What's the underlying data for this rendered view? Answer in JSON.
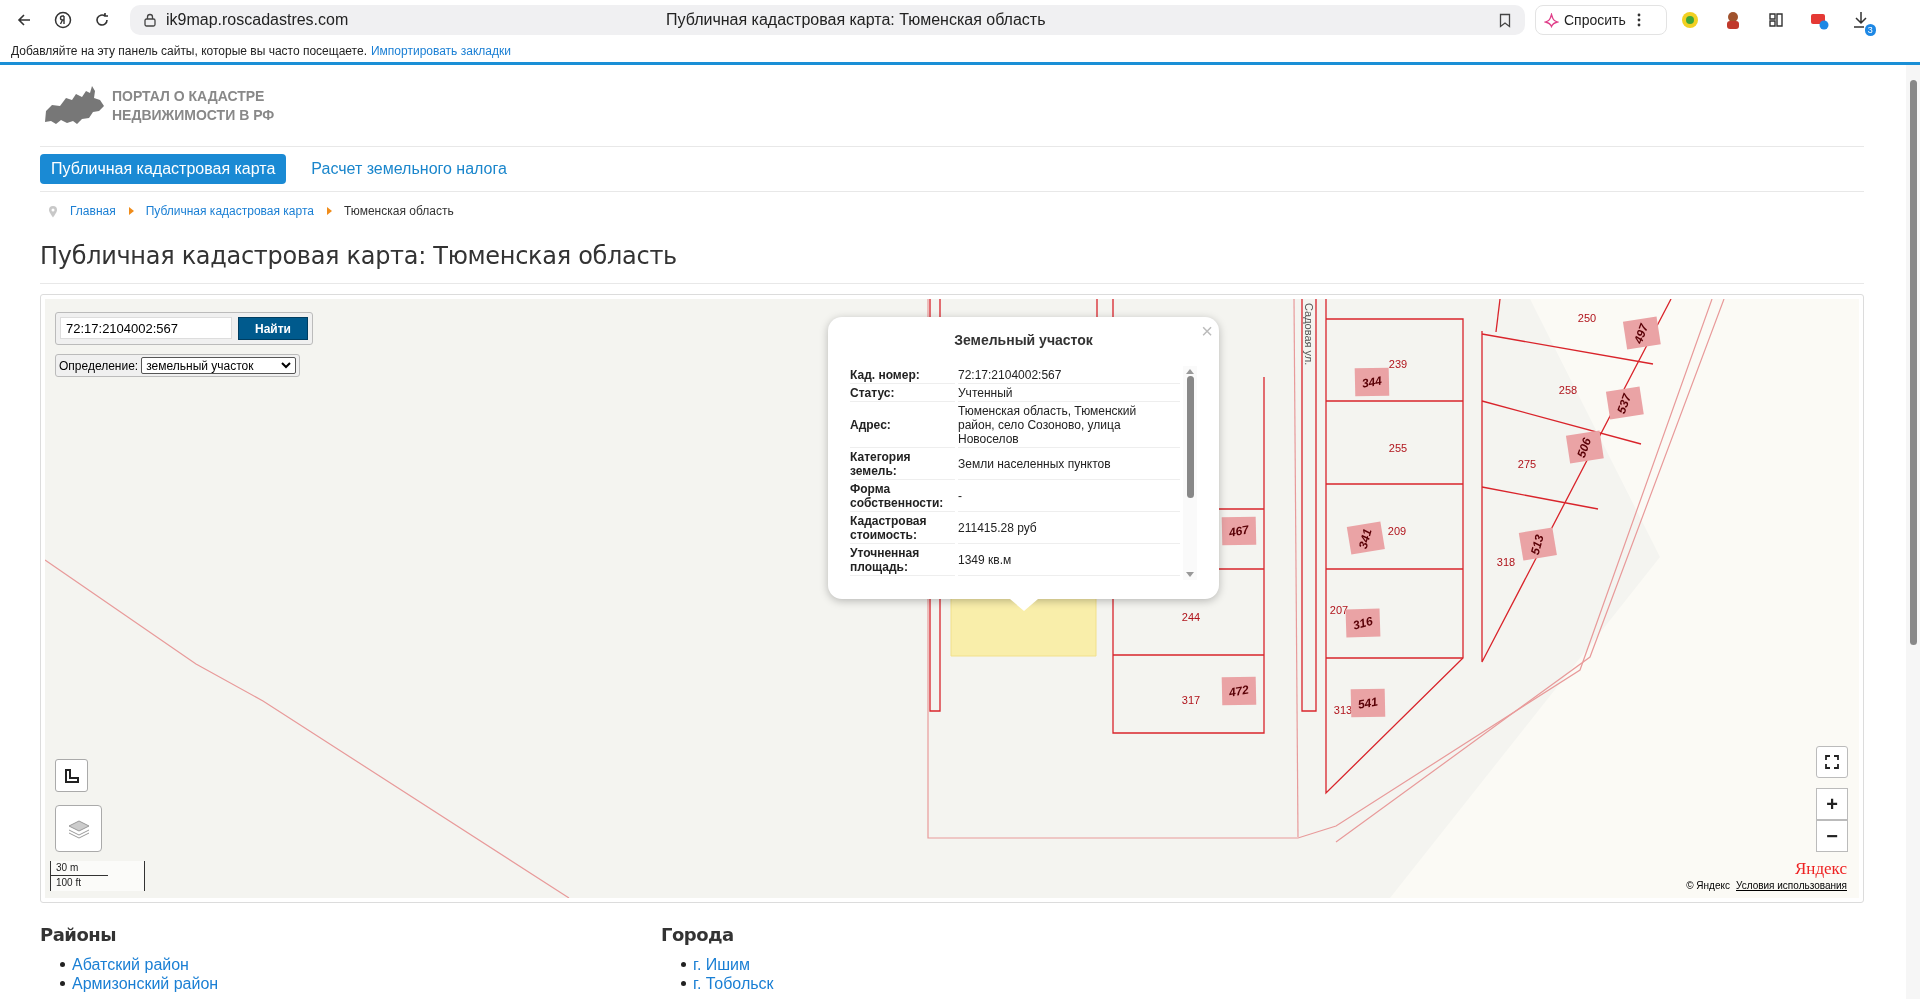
{
  "browser": {
    "url": "ik9map.roscadastres.com",
    "tab_title": "Публичная кадастровая карта: Тюменская область",
    "ask_button": "Спросить",
    "download_badge": "3"
  },
  "bookmarks_bar": {
    "text": "Добавляйте на эту панель сайты, которые вы часто посещаете.",
    "link": "Импортировать закладки"
  },
  "site": {
    "logo_lines": [
      "ПОРТАЛ О КАДАСТРЕ",
      "НЕДВИЖИМОСТИ В РФ"
    ]
  },
  "nav": [
    {
      "label": "Публичная кадастровая карта",
      "selected": true
    },
    {
      "label": "Расчет земельного налога",
      "selected": false
    }
  ],
  "breadcrumbs": [
    {
      "label": "Главная",
      "kind": "link"
    },
    {
      "label": "Публичная кадастровая карта",
      "kind": "link"
    },
    {
      "label": "Тюменская область",
      "kind": "current"
    }
  ],
  "heading": "Публичная кадастровая карта: Тюменская область",
  "map": {
    "search": {
      "value": "72:17:2104002:567",
      "button": "Найти"
    },
    "definition": {
      "label": "Определение:",
      "value": "земельный участок"
    },
    "street_label": "Садовая ул.",
    "plot_labels": [
      {
        "text": "250",
        "kind": "plot"
      },
      {
        "text": "497",
        "kind": "building"
      },
      {
        "text": "239",
        "kind": "plot"
      },
      {
        "text": "344",
        "kind": "building"
      },
      {
        "text": "258",
        "kind": "plot"
      },
      {
        "text": "537",
        "kind": "building"
      },
      {
        "text": "255",
        "kind": "plot"
      },
      {
        "text": "275",
        "kind": "plot"
      },
      {
        "text": "506",
        "kind": "building"
      },
      {
        "text": "467",
        "kind": "building"
      },
      {
        "text": "209",
        "kind": "plot"
      },
      {
        "text": "341",
        "kind": "building"
      },
      {
        "text": "318",
        "kind": "plot"
      },
      {
        "text": "513",
        "kind": "building"
      },
      {
        "text": "207",
        "kind": "plot"
      },
      {
        "text": "316",
        "kind": "building"
      },
      {
        "text": "244",
        "kind": "plot"
      },
      {
        "text": "317",
        "kind": "plot"
      },
      {
        "text": "472",
        "kind": "building"
      },
      {
        "text": "313",
        "kind": "plot"
      },
      {
        "text": "541",
        "kind": "building"
      }
    ],
    "popup": {
      "title": "Земельный участок",
      "close": "×",
      "rows": [
        {
          "label": "Кад. номер:",
          "value": "72:17:2104002:567"
        },
        {
          "label": "Статус:",
          "value": "Учтенный"
        },
        {
          "label": "Адрес:",
          "value": "Тюменская область, Тюменский район, село Созоново, улица Новоселов"
        },
        {
          "label": "Категория земель:",
          "value": "Земли населенных пунктов"
        },
        {
          "label": "Форма собственности:",
          "value": "-"
        },
        {
          "label": "Кадастровая стоимость:",
          "value": "211415.28 руб"
        },
        {
          "label": "Уточненная площадь:",
          "value": "1349 кв.м"
        }
      ]
    },
    "scale": [
      "30 m",
      "100 ft"
    ],
    "zoom_in": "+",
    "zoom_out": "−",
    "provider_logo": "Яндекс",
    "copyright": "© Яндекс",
    "terms_link": "Условия использования"
  },
  "districts": {
    "title": "Районы",
    "items": [
      "Абатский район",
      "Армизонский район"
    ]
  },
  "cities": {
    "title": "Города",
    "items": [
      "г. Ишим",
      "г. Тобольск"
    ]
  }
}
